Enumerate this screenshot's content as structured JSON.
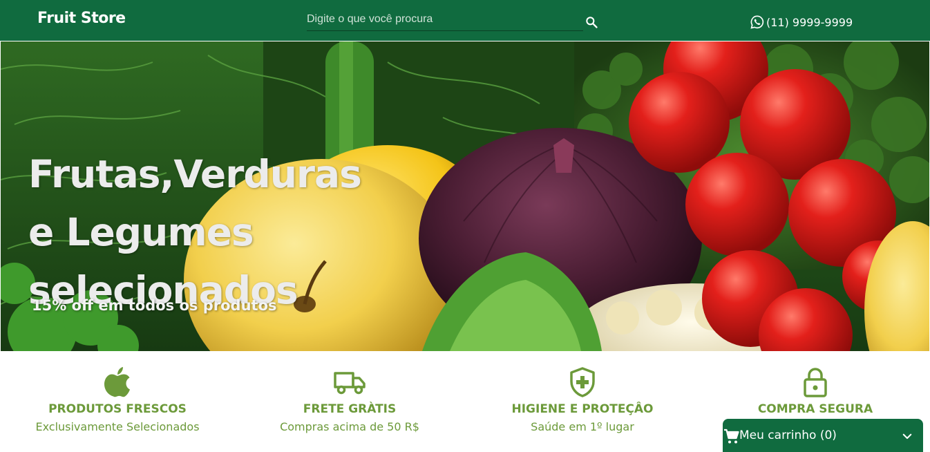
{
  "header": {
    "logo": "Fruit Store",
    "search_placeholder": "Digite o que você procura",
    "phone": "(11) 9999-9999",
    "icons": {
      "search": "search-icon",
      "phone": "whatsapp-icon"
    }
  },
  "hero": {
    "title_lines": [
      "Frutas,Verduras",
      "e Legumes",
      "selecionados"
    ],
    "subtitle": "15% off em todos os produtos"
  },
  "features": [
    {
      "icon": "apple-icon",
      "title": "PRODUTOS FRESCOS",
      "subtitle": "Exclusivamente Selecionados"
    },
    {
      "icon": "truck-icon",
      "title": "FRETE GRÀTIS",
      "subtitle": "Compras acima de 50 R$"
    },
    {
      "icon": "shield-plus-icon",
      "title": "HIGIENE E PROTEÇÂO",
      "subtitle": "Saúde em 1º lugar"
    },
    {
      "icon": "lock-icon",
      "title": "COMPRA SEGURA",
      "subtitle": ""
    }
  ],
  "cart": {
    "label": "Meu carrinho (0)",
    "icon": "cart-icon",
    "toggle_icon": "chevron-down-icon"
  },
  "colors": {
    "header_bg": "#106b3f",
    "accent_green": "#6c9a3a",
    "hero_text": "#ececec"
  }
}
